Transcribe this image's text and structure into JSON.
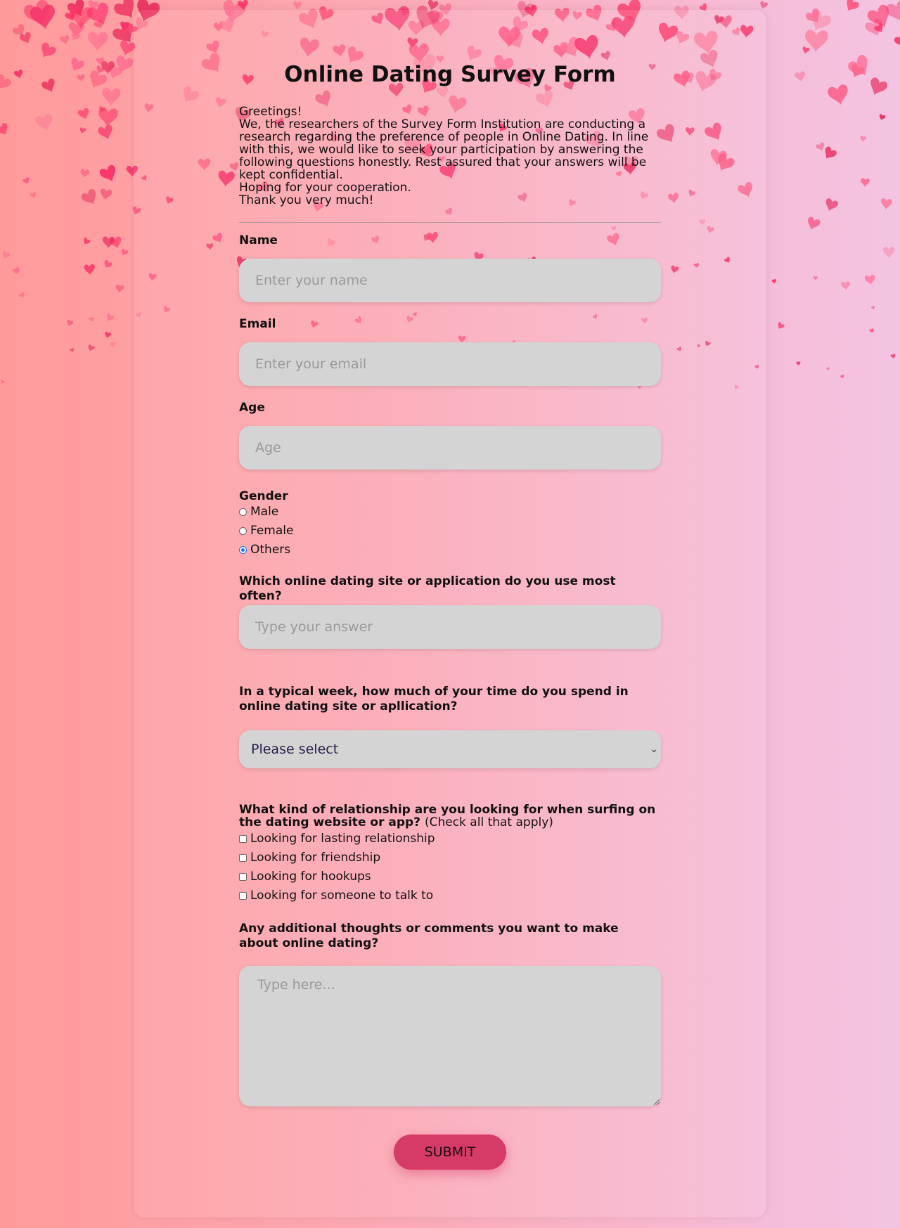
{
  "colors": {
    "accent": "#d63a66",
    "field_bg": "#d4d4d4",
    "radio_selected": "#1a73e8"
  },
  "title": "Online Dating Survey Form",
  "intro": [
    "Greetings!",
    "We, the researchers of the Survey Form Institution are conducting a research regarding the preference of people in Online Dating. In line with this, we would like to seek your participation by answering the following questions honestly. Rest assured that your answers will be kept confidential.",
    "Hoping for your cooperation.",
    "Thank you very much!"
  ],
  "name": {
    "label": "Name",
    "placeholder": "Enter your name"
  },
  "email": {
    "label": "Email",
    "placeholder": "Enter your email"
  },
  "age": {
    "label": "Age",
    "placeholder": "Age"
  },
  "gender": {
    "label": "Gender",
    "options": [
      "Male",
      "Female",
      "Others"
    ],
    "selected": "Others"
  },
  "site": {
    "label": "Which online dating site or application do you use most often?",
    "placeholder": "Type your answer"
  },
  "time": {
    "label": "In a typical week, how much of your time do you spend in online dating site or apllication?",
    "value": "Please select"
  },
  "relationship": {
    "label": "What kind of relationship are you looking for when surfing on the dating website or app?",
    "hint": "(Check all that apply)",
    "options": [
      "Looking for lasting relationship",
      "Looking for friendship",
      "Looking for hookups",
      "Looking for someone to talk to"
    ]
  },
  "comments": {
    "label": "Any additional thoughts or comments you want to make about online dating?",
    "placeholder": "Type here..."
  },
  "submit_label": "SUBMIT"
}
